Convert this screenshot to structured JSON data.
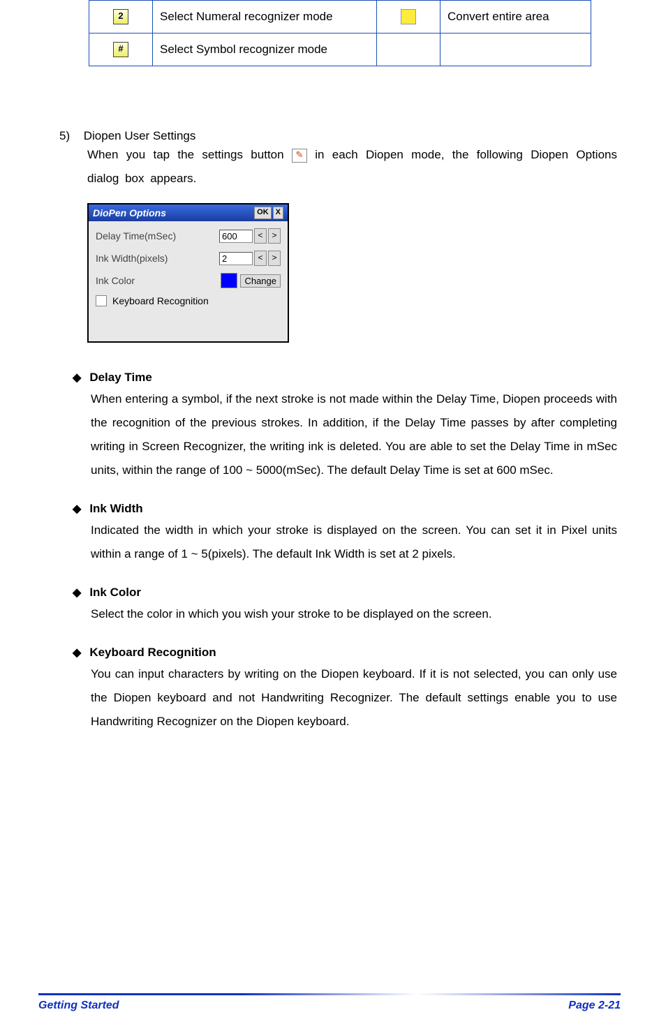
{
  "table": {
    "row1": {
      "label": "Select Numeral recognizer mode",
      "label2": "Convert entire area"
    },
    "row2": {
      "label": "Select Symbol recognizer mode"
    }
  },
  "section5": {
    "num": "5)",
    "title": "Diopen User Settings",
    "body_pre": "When you tap the settings button ",
    "body_post": " in each Diopen mode, the following Diopen Options dialog box appears."
  },
  "dialog": {
    "title": "DioPen Options",
    "ok": "OK",
    "close": "X",
    "delay_label": "Delay Time(mSec)",
    "delay_value": "600",
    "ink_width_label": "Ink Width(pixels)",
    "ink_width_value": "2",
    "ink_color_label": "Ink Color",
    "change": "Change",
    "keyboard_rec": "Keyboard Recognition",
    "lt": "<",
    "gt": ">"
  },
  "bullets": {
    "delay": {
      "title": "Delay Time",
      "body": "When entering a symbol, if the next stroke is not made within the Delay Time, Diopen proceeds with the recognition of the previous strokes. In addition, if the Delay Time passes by after completing writing in Screen Recognizer, the writing ink is deleted. You are able to set the Delay Time in mSec units, within the range of 100 ~ 5000(mSec). The default Delay Time is set at 600 mSec."
    },
    "inkwidth": {
      "title": "Ink Width",
      "body": "Indicated the width in which your stroke is displayed on the screen. You can set it in Pixel units within a range of 1 ~ 5(pixels). The default Ink Width is set at 2 pixels."
    },
    "inkcolor": {
      "title": "Ink Color",
      "body": "Select the color in which you wish your stroke to be displayed on the screen."
    },
    "keyboard": {
      "title": "Keyboard Recognition",
      "body": "You can input characters by writing on the Diopen keyboard. If it is not selected, you can only use the Diopen keyboard and not Handwriting Recognizer. The default settings enable you to use Handwriting Recognizer on the Diopen keyboard."
    }
  },
  "footer": {
    "left": "Getting Started",
    "right": "Page 2-21"
  }
}
